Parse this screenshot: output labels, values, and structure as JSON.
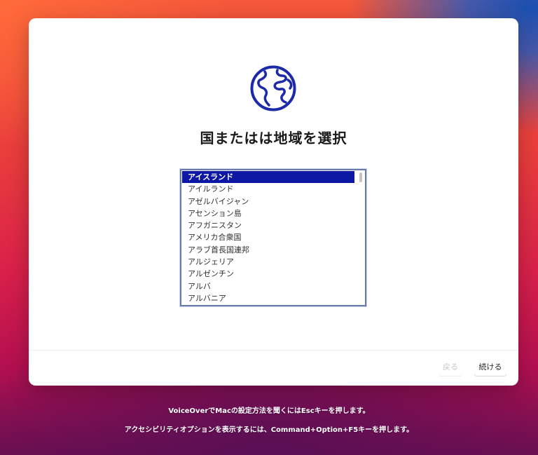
{
  "window": {
    "title": "国またはは地域を選択"
  },
  "globe_icon": "globe-icon",
  "region_list": {
    "items": [
      "アイスランド",
      "アイルランド",
      "アゼルバイジャン",
      "アセンション島",
      "アフガニスタン",
      "アメリカ合衆国",
      "アラブ首長国連邦",
      "アルジェリア",
      "アルゼンチン",
      "アルバ",
      "アルバニア"
    ],
    "selected_item": "アイスランド"
  },
  "buttons": {
    "back_label": "戻る",
    "continue_label": "続ける"
  },
  "hints": {
    "voiceover": "VoiceOverでMacの設定方法を聞くにはEscキーを押します。",
    "accessibility": "アクセシビリティオプションを表示するには、Command+Option+F5キーを押します。"
  },
  "colors": {
    "selection": "#0c17a3",
    "globe": "#1c2aa8",
    "window_background": "#ffffff"
  }
}
